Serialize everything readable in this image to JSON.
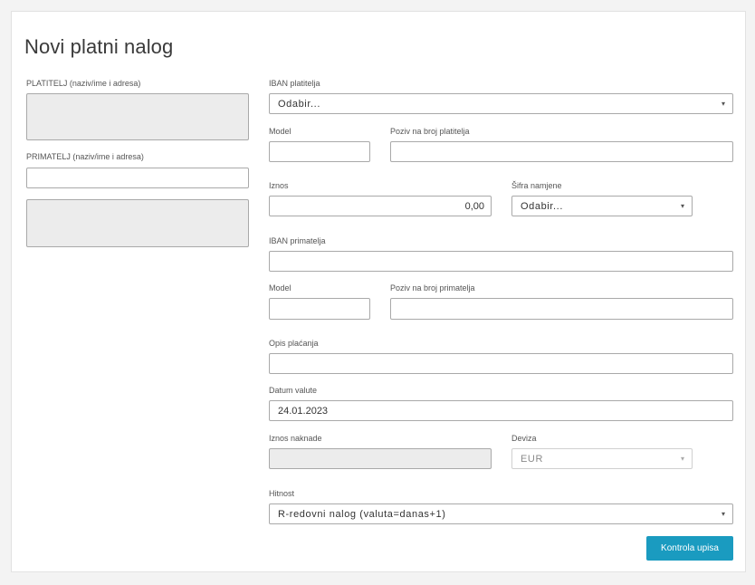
{
  "page_title": "Novi platni nalog",
  "payer": {
    "label": "PLATITELJ (naziv/ime i adresa)"
  },
  "recipient": {
    "label": "PRIMATELJ (naziv/ime i adresa)"
  },
  "payer_iban": {
    "label": "IBAN platitelja",
    "value": "Odabir..."
  },
  "model_payer": {
    "label": "Model"
  },
  "ref_payer": {
    "label": "Poziv na broj platitelja"
  },
  "amount": {
    "label": "Iznos",
    "value": "0,00"
  },
  "purpose_code": {
    "label": "Šifra namjene",
    "value": "Odabir..."
  },
  "recipient_iban": {
    "label": "IBAN primatelja"
  },
  "model_recipient": {
    "label": "Model"
  },
  "ref_recipient": {
    "label": "Poziv na broj primatelja"
  },
  "description": {
    "label": "Opis plaćanja"
  },
  "value_date": {
    "label": "Datum valute",
    "value": "24.01.2023"
  },
  "fee_amount": {
    "label": "Iznos naknade"
  },
  "currency": {
    "label": "Deviza",
    "value": "EUR"
  },
  "urgency": {
    "label": "Hitnost",
    "value": "R-redovni nalog (valuta=danas+1)"
  },
  "submit_button": {
    "label": "Kontrola upisa"
  },
  "colors": {
    "accent": "#1a9bc0",
    "disabled_fill": "#ececec"
  }
}
